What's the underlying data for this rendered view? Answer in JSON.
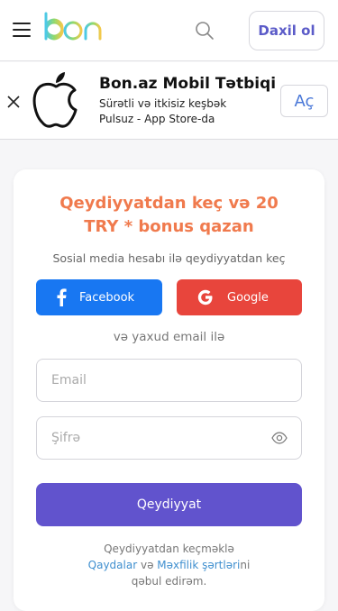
{
  "header": {
    "logo_text": "bon",
    "login_label": "Daxil ol",
    "icons": {
      "menu": "hamburger-icon",
      "search": "search-icon"
    }
  },
  "banner": {
    "title": "Bon.az Mobil Tətbiqi",
    "subtitle": "Sürətli və itkisiz keşbək",
    "subtitle2": "Pulsuz - App Store-da",
    "open_label": "Aç",
    "icons": {
      "close": "close-icon",
      "app": "apple-icon"
    }
  },
  "signup": {
    "title_line1": "Qeydiyyatdan keç və 20",
    "title_line2": "TRY * bonus qazan",
    "social_caption": "Sosial media hesabı ilə qeydiyyatdan keç",
    "facebook_label": "Facebook",
    "google_label": "Google",
    "or_caption": "və yaxud email ilə",
    "email_placeholder": "Email",
    "email_value": "",
    "password_placeholder": "Şifrə",
    "password_value": "",
    "register_label": "Qeydiyyat",
    "terms_line1": "Qeydiyyatdan keçməklə",
    "terms_link1": "Qaydalar",
    "terms_and": " və ",
    "terms_link2": "Məxfilik şərtləri",
    "terms_suffix": "ni",
    "terms_line3": "qəbul edirəm."
  },
  "colors": {
    "accent": "#6153cd",
    "title": "#f07a4d",
    "facebook": "#1877f2",
    "google": "#e8453c",
    "link": "#3f8fcf",
    "logo_gradient": [
      "#4cc9e8",
      "#8fd96a",
      "#f2c94c"
    ]
  }
}
